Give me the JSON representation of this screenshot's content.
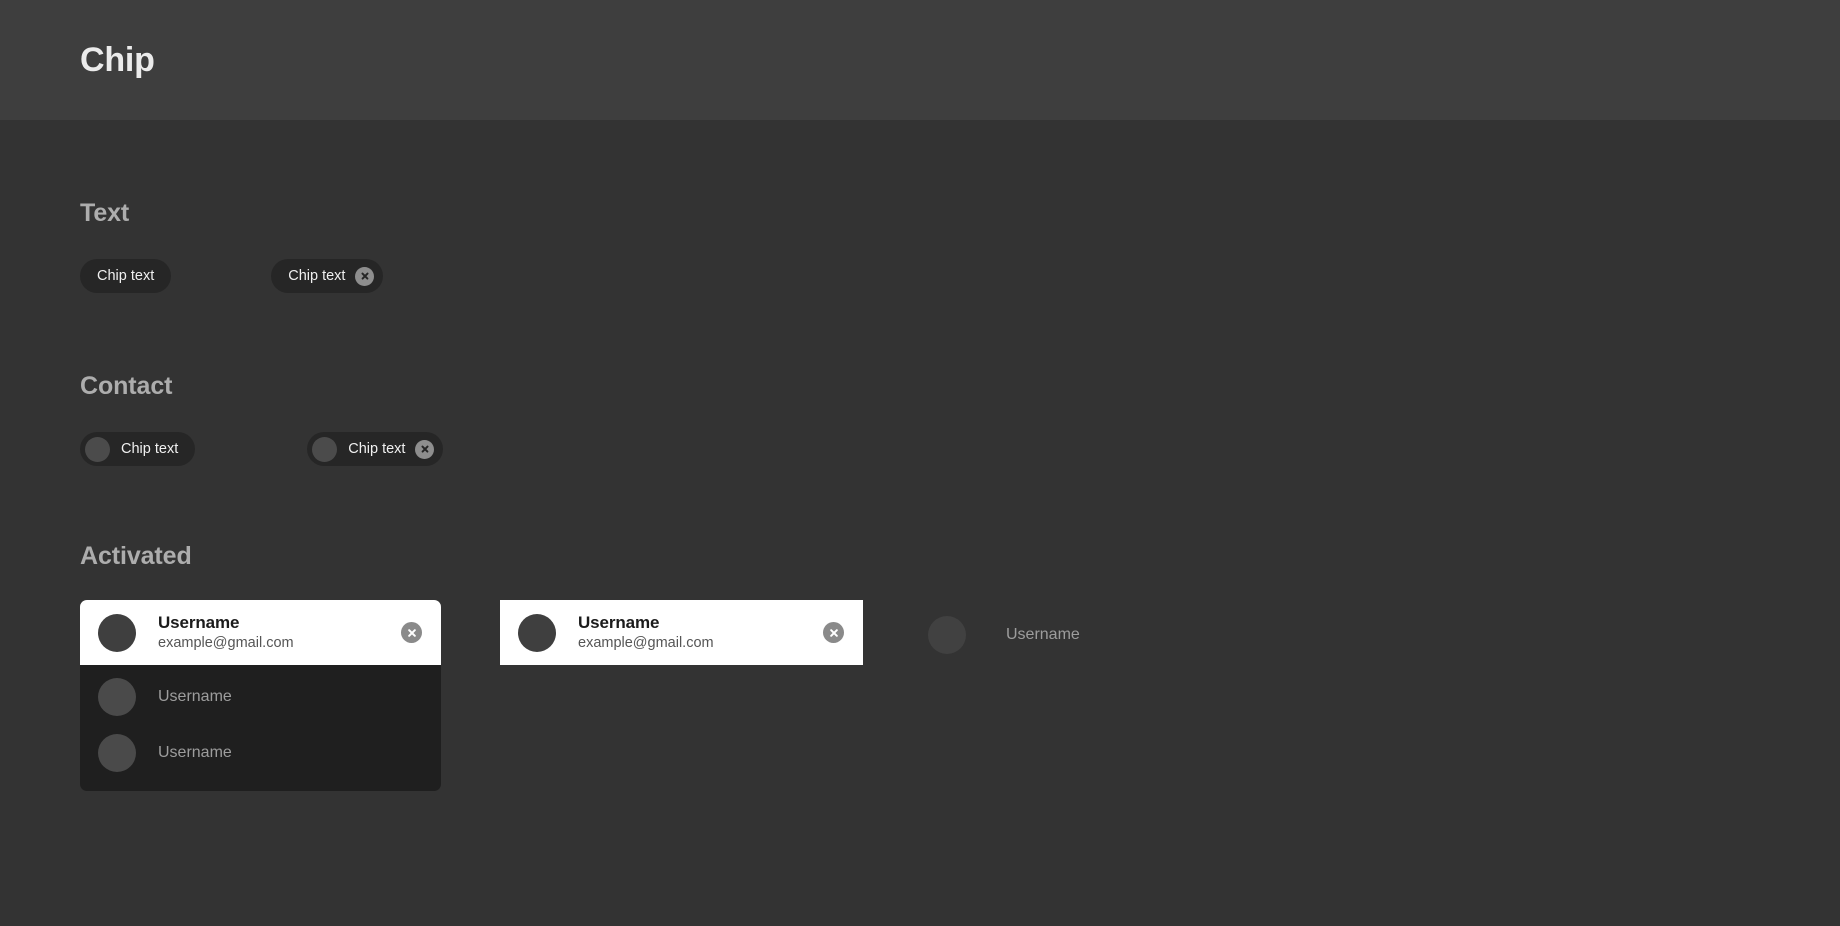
{
  "appbar": {
    "title": "Chip"
  },
  "sections": {
    "text": {
      "title": "Text",
      "chips": [
        {
          "label": "Chip text",
          "dismissible": false
        },
        {
          "label": "Chip text",
          "dismissible": true
        }
      ]
    },
    "contact": {
      "title": "Contact",
      "chips": [
        {
          "label": "Chip text",
          "dismissible": false
        },
        {
          "label": "Chip text",
          "dismissible": true
        }
      ]
    },
    "activated": {
      "title": "Activated",
      "cards": [
        {
          "name": "Username",
          "email": "example@gmail.com"
        },
        {
          "name": "Username",
          "email": "example@gmail.com"
        }
      ],
      "dropdown_items": [
        {
          "label": "Username"
        },
        {
          "label": "Username"
        }
      ],
      "plain_item": {
        "label": "Username"
      }
    }
  },
  "icons": {
    "close": "close-circle-icon",
    "avatar": "avatar-icon"
  },
  "colors": {
    "appbar_bg": "#3e3e3e",
    "page_bg": "#333333",
    "chip_bg": "#262626",
    "dropdown_bg": "#1f1f1f",
    "card_bg": "#ffffff",
    "close_circle": "#8a8a8a",
    "section_title": "#adadad"
  }
}
